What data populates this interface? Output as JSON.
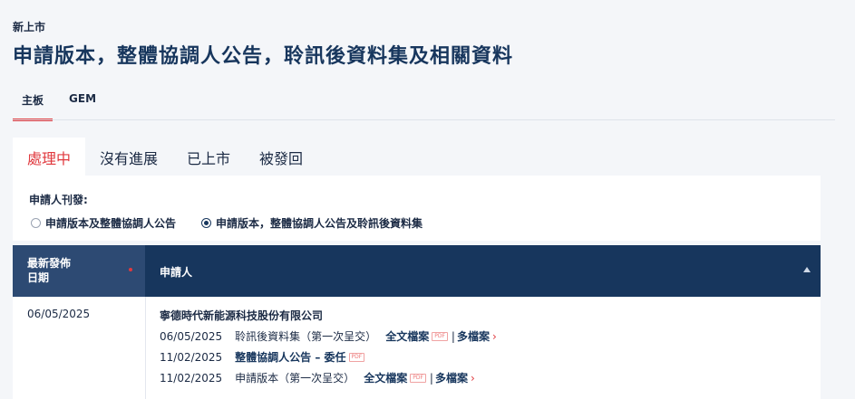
{
  "breadcrumb": "新上市",
  "page_title": "申請版本，整體協調人公告，聆訊後資料集及相關資料",
  "board_tabs": [
    {
      "label": "主板",
      "active": true
    },
    {
      "label": "GEM",
      "active": false
    }
  ],
  "status_tabs": [
    {
      "label": "處理中",
      "active": true
    },
    {
      "label": "沒有進展",
      "active": false
    },
    {
      "label": "已上市",
      "active": false
    },
    {
      "label": "被發回",
      "active": false
    }
  ],
  "filter": {
    "label": "申請人刊發:",
    "options": [
      {
        "label": "申請版本及整體協調人公告",
        "checked": false
      },
      {
        "label": "申請版本，整體協調人公告及聆訊後資料集",
        "checked": true
      }
    ]
  },
  "table": {
    "headers": {
      "date": "最新發佈日期",
      "date_line1": "最新發佈",
      "date_line2": "日期",
      "applicant": "申請人"
    },
    "rows": [
      {
        "date": "06/05/2025",
        "company": "寧德時代新能源科技股份有限公司",
        "documents": [
          {
            "date": "06/05/2025",
            "title": "聆訊後資料集（第一次呈交）",
            "full_text": "全文檔案",
            "pdf": "PDF",
            "separator": "|",
            "multi": "多檔案",
            "chevron": "›"
          },
          {
            "date": "11/02/2025",
            "title": "整體協調人公告 – 委任",
            "pdf": "PDF"
          },
          {
            "date": "11/02/2025",
            "title": "申請版本（第一次呈交）",
            "full_text": "全文檔案",
            "pdf": "PDF",
            "separator": "|",
            "multi": "多檔案",
            "chevron": "›"
          }
        ]
      }
    ]
  },
  "colors": {
    "navy": "#17365d",
    "accent_red": "#e0393e",
    "header_date_bg": "#2d4a73"
  }
}
